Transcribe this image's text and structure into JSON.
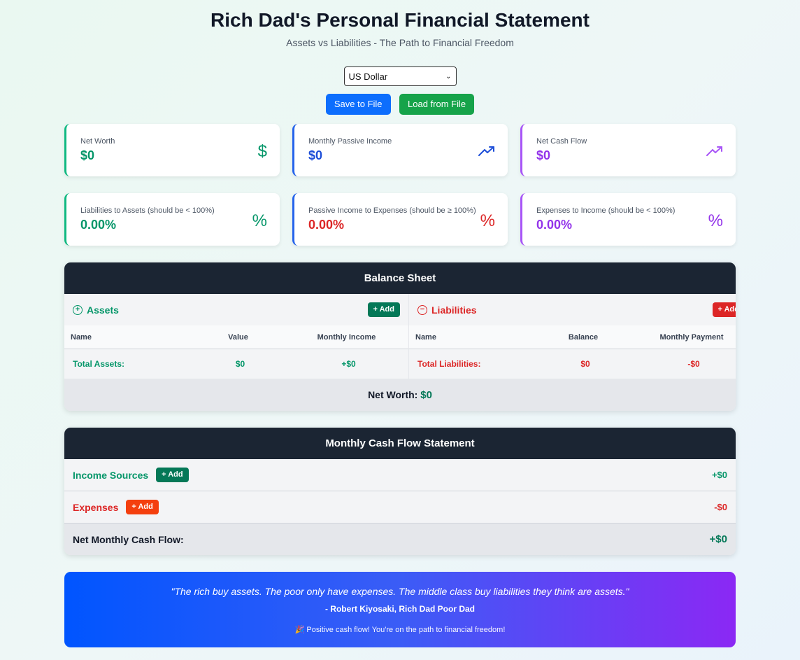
{
  "header": {
    "title": "Rich Dad's Personal Financial Statement",
    "subtitle": "Assets vs Liabilities - The Path to Financial Freedom"
  },
  "currency": {
    "selected": "US Dollar"
  },
  "file_actions": {
    "save_label": "Save to File",
    "load_label": "Load from File"
  },
  "metrics": [
    {
      "label": "Net Worth",
      "value": "$0",
      "icon": "dollar-icon",
      "color": "#059669"
    },
    {
      "label": "Monthly Passive Income",
      "value": "$0",
      "icon": "trending-up-icon",
      "color": "#1d4ed8"
    },
    {
      "label": "Net Cash Flow",
      "value": "$0",
      "icon": "trending-up-icon",
      "color": "#9333ea"
    },
    {
      "label": "Liabilities to Assets (should be < 100%)",
      "value": "0.00%",
      "icon": "percent-icon",
      "color": "#059669"
    },
    {
      "label": "Passive Income to Expenses (should be ≥ 100%)",
      "value": "0.00%",
      "icon": "percent-icon",
      "color": "#dc2626"
    },
    {
      "label": "Expenses to Income (should be < 100%)",
      "value": "0.00%",
      "icon": "percent-icon",
      "color": "#9333ea"
    }
  ],
  "balance_sheet": {
    "title": "Balance Sheet",
    "assets": {
      "heading": "Assets",
      "add_label": "Add",
      "columns": [
        "Name",
        "Value",
        "Monthly Income"
      ],
      "total_label": "Total Assets:",
      "total_value": "$0",
      "total_income": "+$0"
    },
    "liabilities": {
      "heading": "Liabilities",
      "add_label": "Add",
      "columns": [
        "Name",
        "Balance",
        "Monthly Payment"
      ],
      "total_label": "Total Liabilities:",
      "total_balance": "$0",
      "total_payment": "-$0"
    },
    "net_worth_label": "Net Worth:",
    "net_worth_value": "$0"
  },
  "cash_flow": {
    "title": "Monthly Cash Flow Statement",
    "income_label": "Income Sources",
    "income_add": "Add",
    "income_total": "+$0",
    "expenses_label": "Expenses",
    "expenses_add": "Add",
    "expenses_total": "-$0",
    "net_label": "Net Monthly Cash Flow:",
    "net_value": "+$0"
  },
  "quote": {
    "text": "\"The rich buy assets. The poor only have expenses. The middle class buy liabilities they think are assets.\"",
    "author": "- Robert Kiyosaki, Rich Dad Poor Dad",
    "message": "🎉 Positive cash flow! You're on the path to financial freedom!"
  },
  "colors": {
    "green": "#059669",
    "blue": "#1d4ed8",
    "purple": "#9333ea",
    "red": "#dc2626",
    "header_dark": "#1b2533"
  }
}
